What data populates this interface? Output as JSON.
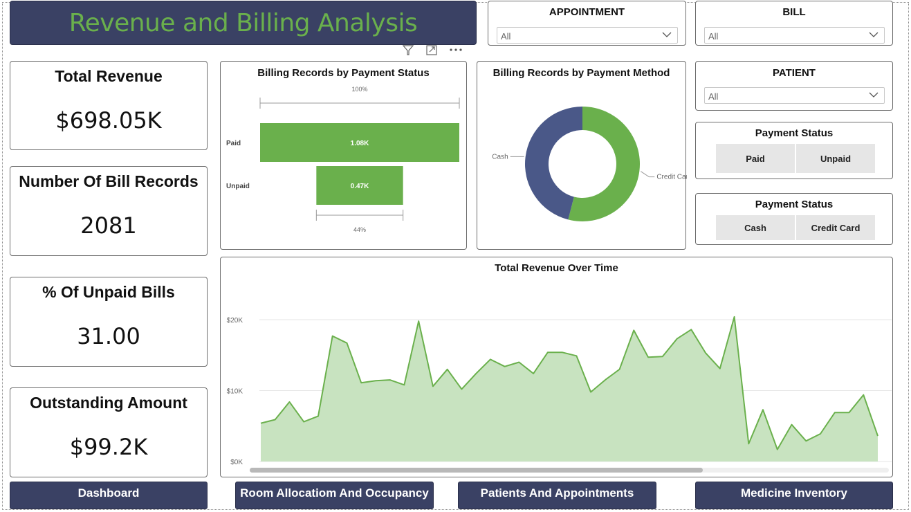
{
  "header": {
    "title": "Revenue and Billing Analysis"
  },
  "kpis": {
    "total_revenue": {
      "label": "Total Revenue",
      "value": "$698.05K"
    },
    "bill_records": {
      "label": "Number Of Bill Records",
      "value": "2081"
    },
    "unpaid_pct": {
      "label": "% Of Unpaid Bills",
      "value": "31.00"
    },
    "outstanding": {
      "label": "Outstanding Amount",
      "value": "$99.2K"
    }
  },
  "slicers": {
    "appointment": {
      "title": "APPOINTMENT",
      "value": "All"
    },
    "bill": {
      "title": "BILL",
      "value": "All"
    },
    "patient": {
      "title": "PATIENT",
      "value": "All"
    },
    "payment_status": {
      "title": "Payment Status",
      "options": [
        "Paid",
        "Unpaid"
      ]
    },
    "payment_method": {
      "title": "Payment Status",
      "options": [
        "Cash",
        "Credit Card"
      ]
    }
  },
  "nav": {
    "dashboard": "Dashboard",
    "rooms": "Room Allocatiom And Occupancy",
    "patients": "Patients And Appointments",
    "medicine": "Medicine Inventory"
  },
  "accent": "#6ab04c",
  "navy": "#3a4164",
  "chart_data": [
    {
      "type": "bar",
      "title": "Billing Records by Payment Status",
      "categories": [
        "Paid",
        "Unpaid"
      ],
      "values": [
        1080,
        470
      ],
      "data_labels": [
        "1.08K",
        "0.47K"
      ],
      "top_label": "100%",
      "bottom_label": "44%",
      "orientation": "funnel"
    },
    {
      "type": "pie",
      "title": "Billing Records by Payment Method",
      "categories": [
        "Credit Card",
        "Cash"
      ],
      "values": [
        54,
        46
      ],
      "colors": [
        "#6ab04c",
        "#4a5888"
      ],
      "donut": true
    },
    {
      "type": "area",
      "title": "Total Revenue Over Time",
      "yticks": [
        "$0K",
        "$10K",
        "$20K"
      ],
      "ylim": [
        0,
        20000
      ],
      "values": [
        5400,
        5900,
        8400,
        5600,
        6400,
        17700,
        16700,
        11100,
        11400,
        11500,
        10800,
        19800,
        10600,
        13000,
        10200,
        12400,
        14400,
        13400,
        14000,
        12400,
        15400,
        15400,
        14900,
        9800,
        11500,
        13000,
        18500,
        14700,
        14800,
        17300,
        18600,
        15300,
        13100,
        20400,
        2500,
        7300,
        1700,
        5200,
        2900,
        3900,
        6900,
        6900,
        9400,
        3600
      ],
      "grid": true
    }
  ]
}
